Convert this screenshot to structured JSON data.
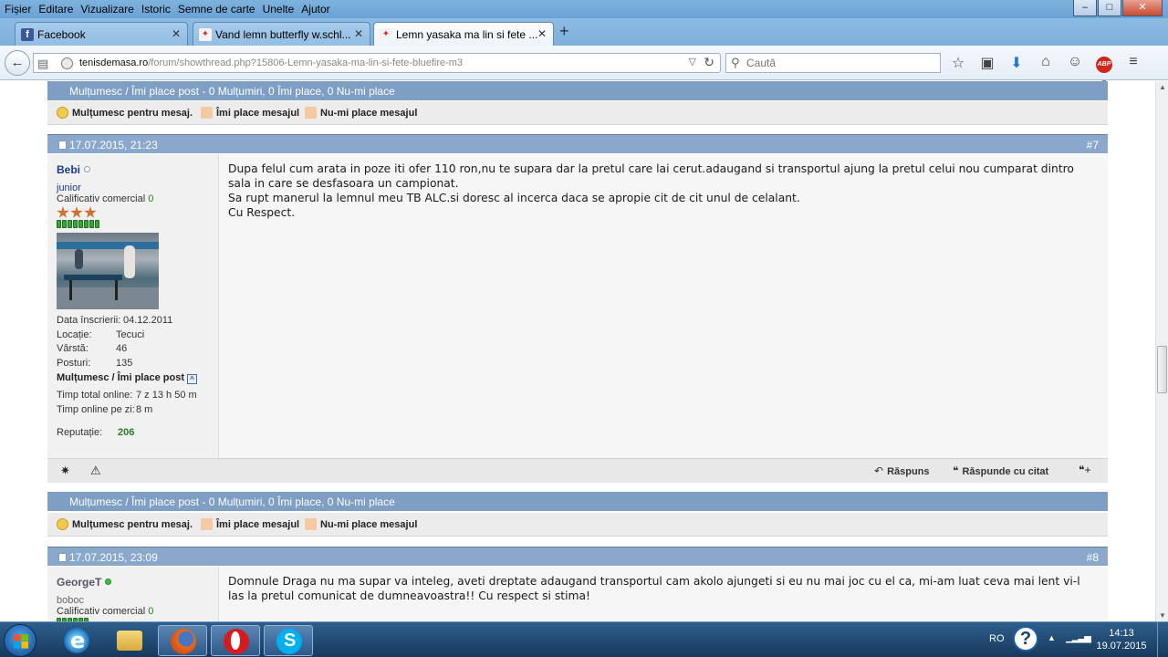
{
  "menu": [
    "Fișier",
    "Editare",
    "Vizualizare",
    "Istoric",
    "Semne de carte",
    "Unelte",
    "Ajutor"
  ],
  "window_controls": {
    "minimize": "–",
    "maximize": "□",
    "close": "✕"
  },
  "tabs": [
    {
      "label": "Facebook",
      "icon": "facebook-icon",
      "icon_color": "#3b5998",
      "active": false
    },
    {
      "label": "Vand lemn butterfly w.schl...",
      "icon": "site-favicon",
      "icon_color": "#d9d9d9",
      "active": false
    },
    {
      "label": "Lemn yasaka ma lin si fete ...",
      "icon": "site-favicon",
      "icon_color": "#d9d9d9",
      "active": true
    }
  ],
  "tab_close": "✕",
  "new_tab": "+",
  "nav": {
    "back": "←",
    "url_domain": "tenisdemasa.ro",
    "url_path": "/forum/showthread.php?15806-Lemn-yasaka-ma-lin-si-fete-bluefire-m3",
    "search_placeholder": "Caută",
    "toolbar_icons": [
      "bookmark-star-icon",
      "reading-list-icon",
      "download-icon",
      "home-icon",
      "chat-icon",
      "adblock-icon",
      "menu-icon"
    ]
  },
  "colors": {
    "header_bar": "#8aa8cc",
    "thanks_bar": "#7f9ec4",
    "accent_green": "#2a7a2a",
    "username_blue": "#1a3a8a"
  },
  "thanks_bar_1": "Mulțumesc / Îmi place post - 0 Mulțumiri, 0 Îmi place, 0 Nu-mi place",
  "like_bar_1": {
    "thanks": "Mulțumesc pentru mesaj.",
    "like": "Îmi place mesajul",
    "dislike": "Nu-mi place mesajul"
  },
  "post7": {
    "date": "17.07.2015, 21:23",
    "number": "#7",
    "user": {
      "name": "Bebi",
      "status": "offline",
      "title": "junior",
      "commercial_label": "Calificativ comercial",
      "commercial_value": "0",
      "rank_stars": 3,
      "rep_bars": 10,
      "joined_label": "Data înscrierii:",
      "joined": "04.12.2011",
      "location_label": "Locație:",
      "location": "Tecuci",
      "age_label": "Vârstă:",
      "age": "46",
      "posts_label": "Posturi:",
      "posts": "135",
      "thanks_block": "Mulțumesc / Îmi place post",
      "total_online_label": "Timp total online:",
      "total_online": "7 z 13 h 50 m",
      "per_day_label": "Timp online pe zi:",
      "per_day": "8 m",
      "reputation_label": "Reputație:",
      "reputation": "206"
    },
    "body": [
      "Dupa felul cum arata in poze iti ofer 110 ron,nu te supara dar la pretul care lai cerut.adaugand si transportul ajung la pretul celui nou cumparat dintro",
      "sala in care se desfasoara un campionat.",
      "Sa rupt manerul la lemnul meu TB ALC.si doresc al incerca daca se apropie cit de cit unul de celalant.",
      "Cu Respect."
    ],
    "footer": {
      "reply": "Răspuns",
      "quote": "Răspunde cu citat"
    }
  },
  "thanks_bar_2": "Mulțumesc / Îmi place post - 0 Mulțumiri, 0 Îmi place, 0 Nu-mi place",
  "like_bar_2": {
    "thanks": "Mulțumesc pentru mesaj.",
    "like": "Îmi place mesajul",
    "dislike": "Nu-mi place mesajul"
  },
  "post8": {
    "date": "17.07.2015, 23:09",
    "number": "#8",
    "user": {
      "name": "GeorgeT",
      "status": "online",
      "title": "boboc",
      "commercial_label": "Calificativ comercial",
      "commercial_value": "0"
    },
    "body": [
      "Domnule Draga nu ma supar va inteleg, aveti dreptate adaugand transportul cam akolo ajungeti si eu nu mai joc cu el ca, mi-am luat ceva mai lent vi-l",
      "las la pretul comunicat de dumneavoastra!! Cu respect si stima!"
    ]
  },
  "taskbar": {
    "lang": "RO",
    "time": "14:13",
    "date": "19.07.2015",
    "apps": [
      "internet-explorer-icon",
      "file-explorer-icon",
      "firefox-icon",
      "opera-icon",
      "skype-icon"
    ]
  }
}
